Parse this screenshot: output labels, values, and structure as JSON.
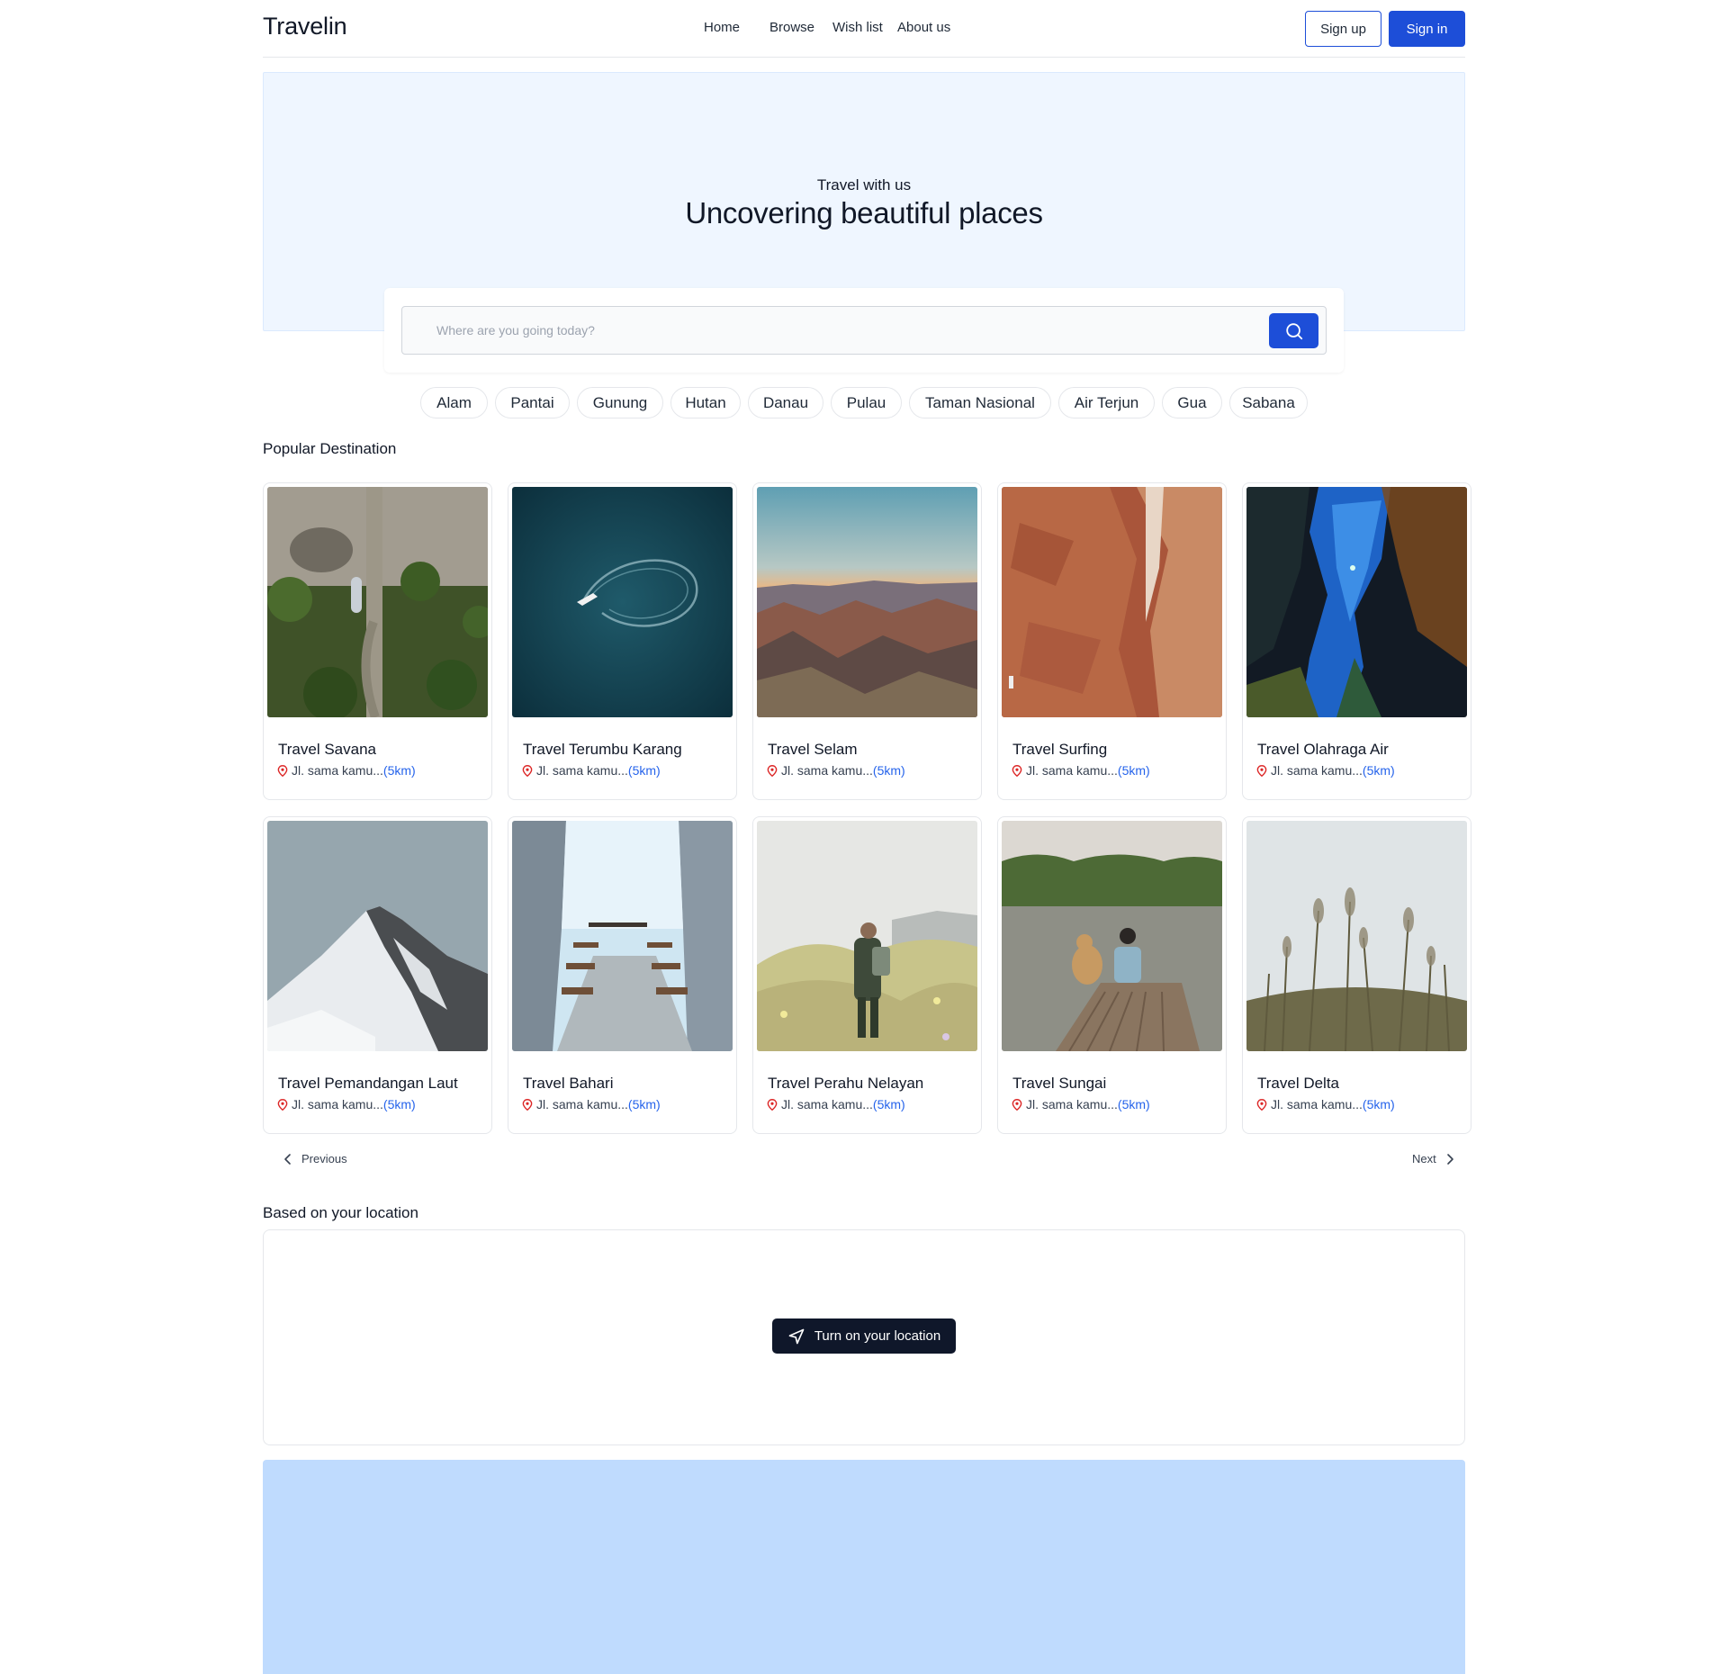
{
  "header": {
    "logo": "Travelin",
    "nav": [
      "Home",
      "Browse",
      "Wish list",
      "About us"
    ],
    "signup_label": "Sign up",
    "signin_label": "Sign in"
  },
  "hero": {
    "kicker": "Travel with us",
    "title": "Uncovering beautiful places",
    "search_placeholder": "Where are you going today?",
    "search_icon": "search-icon"
  },
  "categories": [
    "Alam",
    "Pantai",
    "Gunung",
    "Hutan",
    "Danau",
    "Pulau",
    "Taman Nasional",
    "Air Terjun",
    "Gua",
    "Sabana"
  ],
  "popular": {
    "title": "Popular Destination",
    "cards": [
      {
        "title": "Travel Savana",
        "address": "Jl. sama kamu...",
        "distance": "(5km)",
        "photo": "aerial-beach-path"
      },
      {
        "title": "Travel Terumbu Karang",
        "address": "Jl. sama kamu...",
        "distance": "(5km)",
        "photo": "boat-ocean"
      },
      {
        "title": "Travel Selam",
        "address": "Jl. sama kamu...",
        "distance": "(5km)",
        "photo": "canyon-sunset"
      },
      {
        "title": "Travel Surfing",
        "address": "Jl. sama kamu...",
        "distance": "(5km)",
        "photo": "red-rock-canyon"
      },
      {
        "title": "Travel Olahraga Air",
        "address": "Jl. sama kamu...",
        "distance": "(5km)",
        "photo": "underwater-diver"
      },
      {
        "title": "Travel Pemandangan Laut",
        "address": "Jl. sama kamu...",
        "distance": "(5km)",
        "photo": "snowy-mountain"
      },
      {
        "title": "Travel Bahari",
        "address": "Jl. sama kamu...",
        "distance": "(5km)",
        "photo": "ice-cave"
      },
      {
        "title": "Travel Perahu Nelayan",
        "address": "Jl. sama kamu...",
        "distance": "(5km)",
        "photo": "hiker-flowers"
      },
      {
        "title": "Travel Sungai",
        "address": "Jl. sama kamu...",
        "distance": "(5km)",
        "photo": "dock-lake"
      },
      {
        "title": "Travel Delta",
        "address": "Jl. sama kamu...",
        "distance": "(5km)",
        "photo": "grass-field"
      }
    ],
    "prev_label": "Previous",
    "next_label": "Next"
  },
  "location": {
    "title": "Based on your location",
    "button_label": "Turn on your location",
    "button_icon": "navigation-arrow-icon"
  },
  "colors": {
    "primary": "#1d4ed8",
    "hero_bg": "#eff6ff",
    "footer_bg": "#bfdbfe",
    "dark_button": "#0f172a",
    "pin": "#dc2626",
    "distance": "#2563eb"
  }
}
